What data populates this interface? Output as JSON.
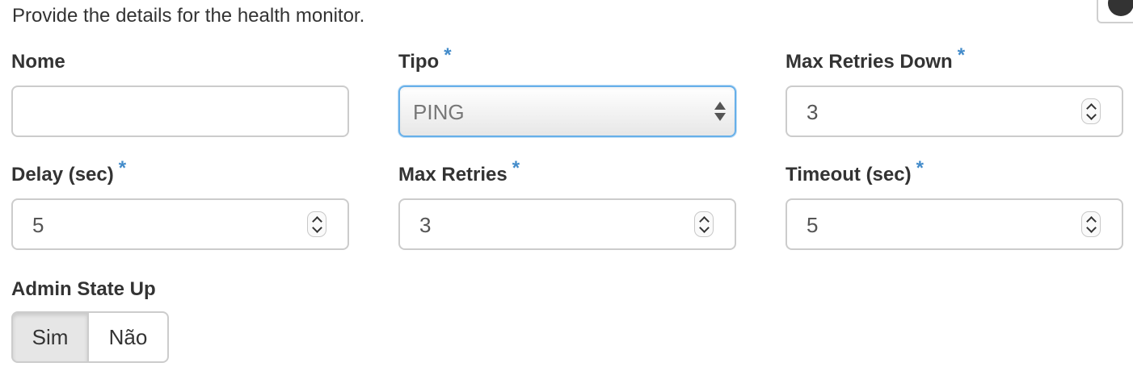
{
  "intro": "Provide the details for the health monitor.",
  "fields": {
    "name": {
      "label": "Nome",
      "value": ""
    },
    "type": {
      "label": "Tipo",
      "required_mark": "*",
      "value": "PING"
    },
    "max_retries_down": {
      "label": "Max Retries Down",
      "required_mark": "*",
      "value": "3"
    },
    "delay": {
      "label": "Delay (sec)",
      "required_mark": "*",
      "value": "5"
    },
    "max_retries": {
      "label": "Max Retries",
      "required_mark": "*",
      "value": "3"
    },
    "timeout": {
      "label": "Timeout (sec)",
      "required_mark": "*",
      "value": "5"
    }
  },
  "admin_state": {
    "label": "Admin State Up",
    "options": [
      "Sim",
      "Não"
    ],
    "selected": "Sim"
  },
  "colors": {
    "required_mark": "#428bca",
    "focus_border": "#66afe9",
    "border": "#cccccc",
    "text": "#333333"
  },
  "icons": {
    "help": "help-icon",
    "spinner_up": "chevron-up-icon",
    "spinner_down": "chevron-down-icon",
    "select": "select-arrows-icon"
  }
}
